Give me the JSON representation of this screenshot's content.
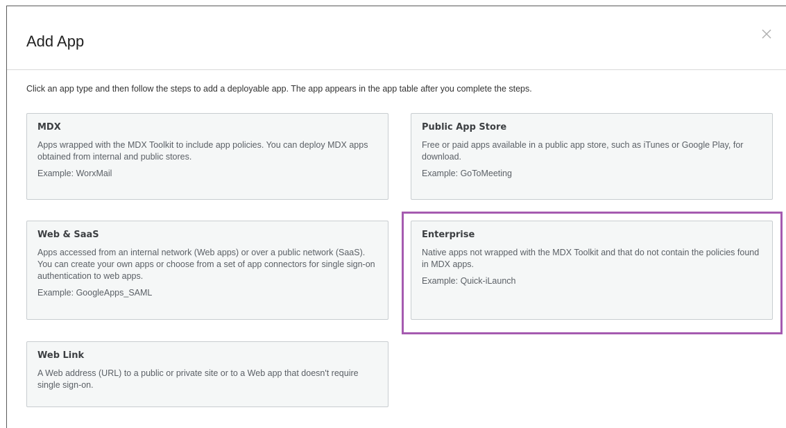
{
  "dialog": {
    "title": "Add App",
    "close_icon": "close-icon",
    "intro": "Click an app type and then follow the steps to add a deployable app. The app appears in the app table after you complete the steps."
  },
  "cards": {
    "mdx": {
      "title": "MDX",
      "description": "Apps wrapped with the MDX Toolkit to include app policies. You can deploy MDX apps obtained from internal and public stores.",
      "example": "Example: WorxMail"
    },
    "public_store": {
      "title": "Public App Store",
      "description": "Free or paid apps available in a public app store, such as iTunes or Google Play, for download.",
      "example": "Example: GoToMeeting"
    },
    "web_saas": {
      "title": "Web & SaaS",
      "description": "Apps accessed from an internal network (Web apps) or over a public network (SaaS). You can create your own apps or choose from a set of app connectors for single sign-on authentication to web apps.",
      "example": "Example: GoogleApps_SAML"
    },
    "enterprise": {
      "title": "Enterprise",
      "description": "Native apps not wrapped with the MDX Toolkit and that do not contain the policies found in MDX apps.",
      "example": "Example: Quick-iLaunch"
    },
    "web_link": {
      "title": "Web Link",
      "description": "A Web address (URL) to a public or private site or to a Web app that doesn't require single sign-on."
    }
  },
  "colors": {
    "highlight": "#a55ab0",
    "card_background": "#f5f7f7",
    "card_border": "#c8cdd0"
  }
}
